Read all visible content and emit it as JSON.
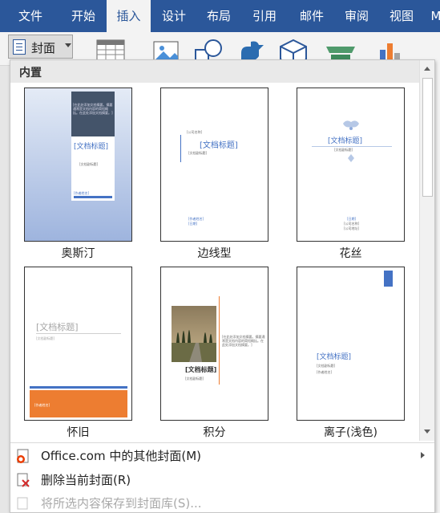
{
  "ribbon": {
    "tabs": [
      "文件",
      "开始",
      "插入",
      "设计",
      "布局",
      "引用",
      "邮件",
      "审阅",
      "视图",
      "M"
    ],
    "active_tab": "插入",
    "cover_button_label": "封面"
  },
  "gallery": {
    "section_title": "内置",
    "covers": [
      {
        "name": "奥斯汀",
        "title": "[文档标题]",
        "subtitle": "[文档副标题]",
        "footer": "[作者姓名]",
        "abstract": "[在此处添加文档摘要。摘要通常是文档内容的简短概括。在此处添加文档摘要。]"
      },
      {
        "name": "边线型",
        "title": "[文档标题]",
        "top": "[公司名称]",
        "subtitle": "[文档副标题]",
        "footer1": "[作者姓名]",
        "footer2": "[日期]"
      },
      {
        "name": "花丝",
        "title": "[文档标题]",
        "subtitle": "[文档副标题]",
        "footer1": "[日期]",
        "footer2": "[公司名称]",
        "footer3": "[公司地址]"
      },
      {
        "name": "怀旧",
        "title": "[文档标题]",
        "subtitle": "[文档副标题]",
        "footer": "[作者姓名]"
      },
      {
        "name": "积分",
        "title": "[文档标题]",
        "subtitle": "[文档副标题]",
        "abstract": "[在此处添加文档摘要。摘要通常是文档内容的简短概括。在此处添加文档摘要。]"
      },
      {
        "name": "离子(浅色)",
        "title": "[文档标题]",
        "subtitle": "[文档副标题]",
        "footer": "[作者姓名]"
      }
    ]
  },
  "menu": {
    "more_covers": "Office.com 中的其他封面(M)",
    "remove_cover": "删除当前封面(R)",
    "save_selection": "将所选内容保存到封面库(S)..."
  },
  "colors": {
    "ribbon_blue": "#2b579a",
    "austin_gradient_top": "#e4ebf6",
    "austin_gradient_bottom": "#9eb4de",
    "retro_orange": "#ed7d31",
    "ion_blue": "#4472c4"
  }
}
